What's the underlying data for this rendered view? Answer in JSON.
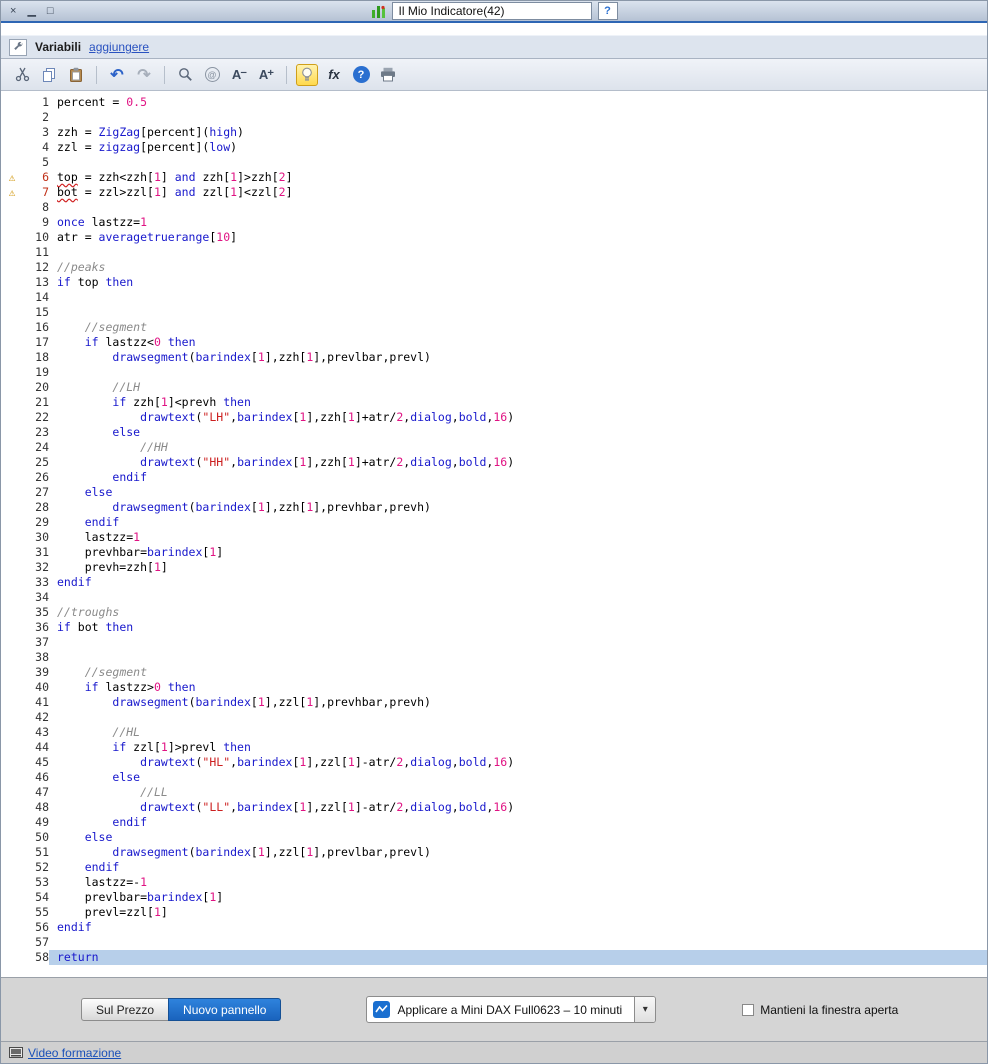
{
  "window": {
    "title": "Il Mio Indicatore(42)",
    "controls": {
      "close": "×",
      "minimize": "▁",
      "maximize": "□"
    }
  },
  "variables_bar": {
    "label": "Variabili",
    "add_link": "aggiungere"
  },
  "toolbar": {
    "icons": [
      "cut-icon",
      "copy-icon",
      "paste-icon",
      "undo-icon",
      "redo-icon",
      "search-icon",
      "find-replace-icon",
      "font-decrease-icon",
      "font-increase-icon",
      "lightbulb-icon",
      "insert-function-icon",
      "help-icon",
      "print-icon"
    ],
    "labels": {
      "undo": "↶",
      "redo": "↷",
      "at": "@",
      "font_decrease": "A⁻",
      "font_increase": "A⁺",
      "fx": "fx",
      "help": "?"
    }
  },
  "editor": {
    "selected_line": 58,
    "warning_lines": [
      6,
      7
    ],
    "lines": [
      [
        [
          "p",
          "percent = "
        ],
        [
          "n",
          "0.5"
        ]
      ],
      [],
      [
        [
          "p",
          "zzh = "
        ],
        [
          "k",
          "ZigZag"
        ],
        [
          "p",
          "[percent]("
        ],
        [
          "k",
          "high"
        ],
        [
          "p",
          ")"
        ]
      ],
      [
        [
          "p",
          "zzl = "
        ],
        [
          "k",
          "zigzag"
        ],
        [
          "p",
          "[percent]("
        ],
        [
          "k",
          "low"
        ],
        [
          "p",
          ")"
        ]
      ],
      [],
      [
        [
          "w",
          "top"
        ],
        [
          "p",
          " = zzh<zzh["
        ],
        [
          "n",
          "1"
        ],
        [
          "p",
          "] "
        ],
        [
          "k",
          "and"
        ],
        [
          "p",
          " zzh["
        ],
        [
          "n",
          "1"
        ],
        [
          "p",
          "]>zzh["
        ],
        [
          "n",
          "2"
        ],
        [
          "p",
          "]"
        ]
      ],
      [
        [
          "w",
          "bot"
        ],
        [
          "p",
          " = zzl>zzl["
        ],
        [
          "n",
          "1"
        ],
        [
          "p",
          "] "
        ],
        [
          "k",
          "and"
        ],
        [
          "p",
          " zzl["
        ],
        [
          "n",
          "1"
        ],
        [
          "p",
          "]<zzl["
        ],
        [
          "n",
          "2"
        ],
        [
          "p",
          "]"
        ]
      ],
      [],
      [
        [
          "k",
          "once"
        ],
        [
          "p",
          " lastzz="
        ],
        [
          "n",
          "1"
        ]
      ],
      [
        [
          "p",
          "atr = "
        ],
        [
          "k",
          "averagetruerange"
        ],
        [
          "p",
          "["
        ],
        [
          "n",
          "10"
        ],
        [
          "p",
          "]"
        ]
      ],
      [],
      [
        [
          "c",
          "//peaks"
        ]
      ],
      [
        [
          "k",
          "if"
        ],
        [
          "p",
          " top "
        ],
        [
          "k",
          "then"
        ]
      ],
      [],
      [],
      [
        [
          "p",
          "    "
        ],
        [
          "c",
          "//segment"
        ]
      ],
      [
        [
          "p",
          "    "
        ],
        [
          "k",
          "if"
        ],
        [
          "p",
          " lastzz<"
        ],
        [
          "n",
          "0"
        ],
        [
          "p",
          " "
        ],
        [
          "k",
          "then"
        ]
      ],
      [
        [
          "p",
          "        "
        ],
        [
          "k",
          "drawsegment"
        ],
        [
          "p",
          "("
        ],
        [
          "k",
          "barindex"
        ],
        [
          "p",
          "["
        ],
        [
          "n",
          "1"
        ],
        [
          "p",
          "],zzh["
        ],
        [
          "n",
          "1"
        ],
        [
          "p",
          "],prevlbar,prevl)"
        ]
      ],
      [],
      [
        [
          "p",
          "        "
        ],
        [
          "c",
          "//LH"
        ]
      ],
      [
        [
          "p",
          "        "
        ],
        [
          "k",
          "if"
        ],
        [
          "p",
          " zzh["
        ],
        [
          "n",
          "1"
        ],
        [
          "p",
          "]<prevh "
        ],
        [
          "k",
          "then"
        ]
      ],
      [
        [
          "p",
          "            "
        ],
        [
          "k",
          "drawtext"
        ],
        [
          "p",
          "("
        ],
        [
          "s",
          "\"LH\""
        ],
        [
          "p",
          ","
        ],
        [
          "k",
          "barindex"
        ],
        [
          "p",
          "["
        ],
        [
          "n",
          "1"
        ],
        [
          "p",
          "],zzh["
        ],
        [
          "n",
          "1"
        ],
        [
          "p",
          "]+atr/"
        ],
        [
          "n",
          "2"
        ],
        [
          "p",
          ","
        ],
        [
          "k",
          "dialog"
        ],
        [
          "p",
          ","
        ],
        [
          "k",
          "bold"
        ],
        [
          "p",
          ","
        ],
        [
          "n",
          "16"
        ],
        [
          "p",
          ")"
        ]
      ],
      [
        [
          "p",
          "        "
        ],
        [
          "k",
          "else"
        ]
      ],
      [
        [
          "p",
          "            "
        ],
        [
          "c",
          "//HH"
        ]
      ],
      [
        [
          "p",
          "            "
        ],
        [
          "k",
          "drawtext"
        ],
        [
          "p",
          "("
        ],
        [
          "s",
          "\"HH\""
        ],
        [
          "p",
          ","
        ],
        [
          "k",
          "barindex"
        ],
        [
          "p",
          "["
        ],
        [
          "n",
          "1"
        ],
        [
          "p",
          "],zzh["
        ],
        [
          "n",
          "1"
        ],
        [
          "p",
          "]+atr/"
        ],
        [
          "n",
          "2"
        ],
        [
          "p",
          ","
        ],
        [
          "k",
          "dialog"
        ],
        [
          "p",
          ","
        ],
        [
          "k",
          "bold"
        ],
        [
          "p",
          ","
        ],
        [
          "n",
          "16"
        ],
        [
          "p",
          ")"
        ]
      ],
      [
        [
          "p",
          "        "
        ],
        [
          "k",
          "endif"
        ]
      ],
      [
        [
          "p",
          "    "
        ],
        [
          "k",
          "else"
        ]
      ],
      [
        [
          "p",
          "        "
        ],
        [
          "k",
          "drawsegment"
        ],
        [
          "p",
          "("
        ],
        [
          "k",
          "barindex"
        ],
        [
          "p",
          "["
        ],
        [
          "n",
          "1"
        ],
        [
          "p",
          "],zzh["
        ],
        [
          "n",
          "1"
        ],
        [
          "p",
          "],prevhbar,prevh)"
        ]
      ],
      [
        [
          "p",
          "    "
        ],
        [
          "k",
          "endif"
        ]
      ],
      [
        [
          "p",
          "    lastzz="
        ],
        [
          "n",
          "1"
        ]
      ],
      [
        [
          "p",
          "    prevhbar="
        ],
        [
          "k",
          "barindex"
        ],
        [
          "p",
          "["
        ],
        [
          "n",
          "1"
        ],
        [
          "p",
          "]"
        ]
      ],
      [
        [
          "p",
          "    prevh=zzh["
        ],
        [
          "n",
          "1"
        ],
        [
          "p",
          "]"
        ]
      ],
      [
        [
          "k",
          "endif"
        ]
      ],
      [],
      [
        [
          "c",
          "//troughs"
        ]
      ],
      [
        [
          "k",
          "if"
        ],
        [
          "p",
          " bot "
        ],
        [
          "k",
          "then"
        ]
      ],
      [],
      [],
      [
        [
          "p",
          "    "
        ],
        [
          "c",
          "//segment"
        ]
      ],
      [
        [
          "p",
          "    "
        ],
        [
          "k",
          "if"
        ],
        [
          "p",
          " lastzz>"
        ],
        [
          "n",
          "0"
        ],
        [
          "p",
          " "
        ],
        [
          "k",
          "then"
        ]
      ],
      [
        [
          "p",
          "        "
        ],
        [
          "k",
          "drawsegment"
        ],
        [
          "p",
          "("
        ],
        [
          "k",
          "barindex"
        ],
        [
          "p",
          "["
        ],
        [
          "n",
          "1"
        ],
        [
          "p",
          "],zzl["
        ],
        [
          "n",
          "1"
        ],
        [
          "p",
          "],prevhbar,prevh)"
        ]
      ],
      [],
      [
        [
          "p",
          "        "
        ],
        [
          "c",
          "//HL"
        ]
      ],
      [
        [
          "p",
          "        "
        ],
        [
          "k",
          "if"
        ],
        [
          "p",
          " zzl["
        ],
        [
          "n",
          "1"
        ],
        [
          "p",
          "]>prevl "
        ],
        [
          "k",
          "then"
        ]
      ],
      [
        [
          "p",
          "            "
        ],
        [
          "k",
          "drawtext"
        ],
        [
          "p",
          "("
        ],
        [
          "s",
          "\"HL\""
        ],
        [
          "p",
          ","
        ],
        [
          "k",
          "barindex"
        ],
        [
          "p",
          "["
        ],
        [
          "n",
          "1"
        ],
        [
          "p",
          "],zzl["
        ],
        [
          "n",
          "1"
        ],
        [
          "p",
          "]-atr/"
        ],
        [
          "n",
          "2"
        ],
        [
          "p",
          ","
        ],
        [
          "k",
          "dialog"
        ],
        [
          "p",
          ","
        ],
        [
          "k",
          "bold"
        ],
        [
          "p",
          ","
        ],
        [
          "n",
          "16"
        ],
        [
          "p",
          ")"
        ]
      ],
      [
        [
          "p",
          "        "
        ],
        [
          "k",
          "else"
        ]
      ],
      [
        [
          "p",
          "            "
        ],
        [
          "c",
          "//LL"
        ]
      ],
      [
        [
          "p",
          "            "
        ],
        [
          "k",
          "drawtext"
        ],
        [
          "p",
          "("
        ],
        [
          "s",
          "\"LL\""
        ],
        [
          "p",
          ","
        ],
        [
          "k",
          "barindex"
        ],
        [
          "p",
          "["
        ],
        [
          "n",
          "1"
        ],
        [
          "p",
          "],zzl["
        ],
        [
          "n",
          "1"
        ],
        [
          "p",
          "]-atr/"
        ],
        [
          "n",
          "2"
        ],
        [
          "p",
          ","
        ],
        [
          "k",
          "dialog"
        ],
        [
          "p",
          ","
        ],
        [
          "k",
          "bold"
        ],
        [
          "p",
          ","
        ],
        [
          "n",
          "16"
        ],
        [
          "p",
          ")"
        ]
      ],
      [
        [
          "p",
          "        "
        ],
        [
          "k",
          "endif"
        ]
      ],
      [
        [
          "p",
          "    "
        ],
        [
          "k",
          "else"
        ]
      ],
      [
        [
          "p",
          "        "
        ],
        [
          "k",
          "drawsegment"
        ],
        [
          "p",
          "("
        ],
        [
          "k",
          "barindex"
        ],
        [
          "p",
          "["
        ],
        [
          "n",
          "1"
        ],
        [
          "p",
          "],zzl["
        ],
        [
          "n",
          "1"
        ],
        [
          "p",
          "],prevlbar,prevl)"
        ]
      ],
      [
        [
          "p",
          "    "
        ],
        [
          "k",
          "endif"
        ]
      ],
      [
        [
          "p",
          "    lastzz=-"
        ],
        [
          "n",
          "1"
        ]
      ],
      [
        [
          "p",
          "    prevlbar="
        ],
        [
          "k",
          "barindex"
        ],
        [
          "p",
          "["
        ],
        [
          "n",
          "1"
        ],
        [
          "p",
          "]"
        ]
      ],
      [
        [
          "p",
          "    prevl=zzl["
        ],
        [
          "n",
          "1"
        ],
        [
          "p",
          "]"
        ]
      ],
      [
        [
          "k",
          "endif"
        ]
      ],
      [],
      [
        [
          "k",
          "return"
        ]
      ]
    ]
  },
  "bottom_bar": {
    "price_button": "Sul Prezzo",
    "panel_button": "Nuovo pannello",
    "apply_dropdown": "Applicare a Mini DAX Full0623 – 10 minuti",
    "keep_open_label": "Mantieni la finestra aperta",
    "keep_open_checked": false
  },
  "footer": {
    "video_link": "Video formazione"
  },
  "colors": {
    "accent_blue": "#1a63bd",
    "keyword": "#1818cc",
    "number": "#e01383",
    "string": "#cc2020",
    "comment": "#8a8a8a",
    "warning_line": "#c03018",
    "selection": "#b7cfea"
  }
}
